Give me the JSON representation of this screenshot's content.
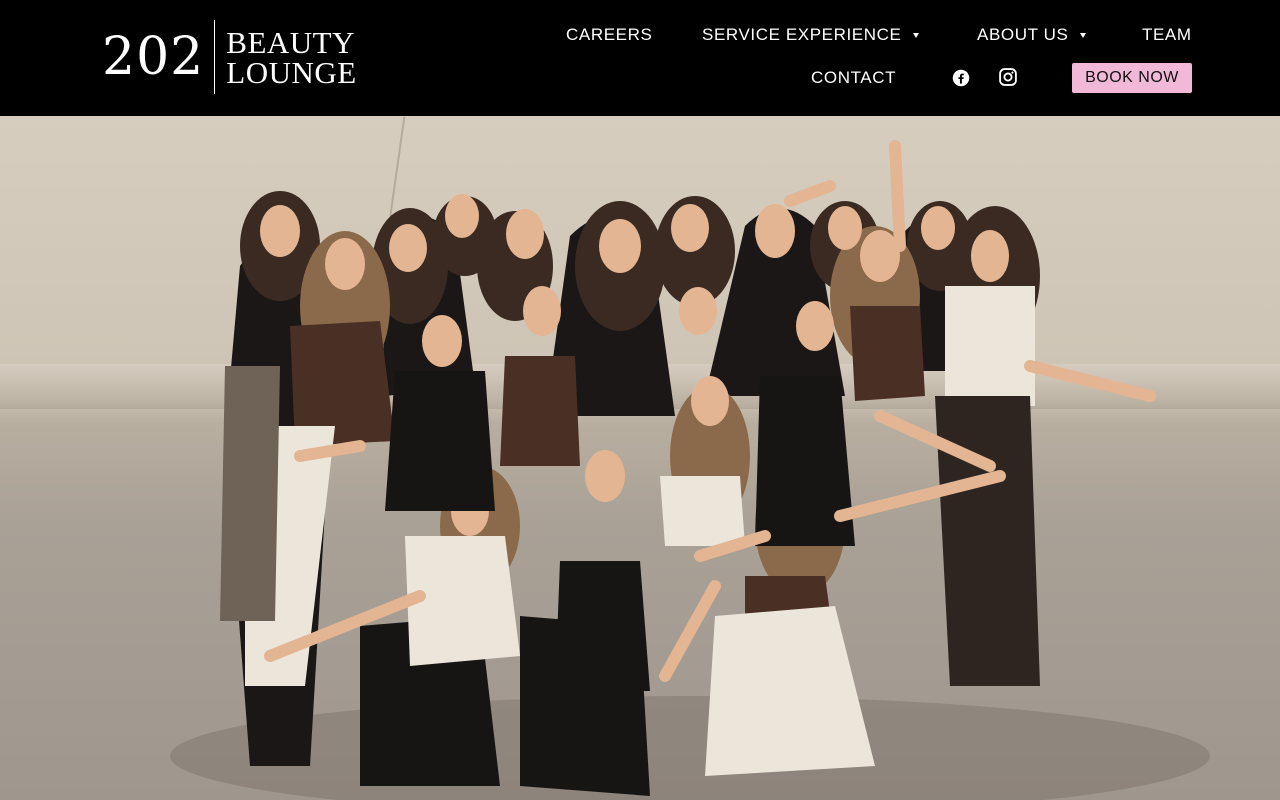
{
  "header": {
    "logo": {
      "number": "202",
      "line1": "BEAUTY",
      "line2": "LOUNGE"
    },
    "nav": {
      "careers": "CAREERS",
      "service_experience": "SERVICE EXPERIENCE",
      "about_us": "ABOUT US",
      "team": "TEAM",
      "contact": "CONTACT"
    },
    "social": {
      "facebook_icon": "facebook-icon",
      "instagram_icon": "instagram-icon"
    },
    "book_button": "BOOK NOW"
  },
  "colors": {
    "header_bg": "#000000",
    "book_button_bg": "#f2b8d8",
    "text": "#ffffff"
  },
  "hero": {
    "image": "team group photo"
  }
}
